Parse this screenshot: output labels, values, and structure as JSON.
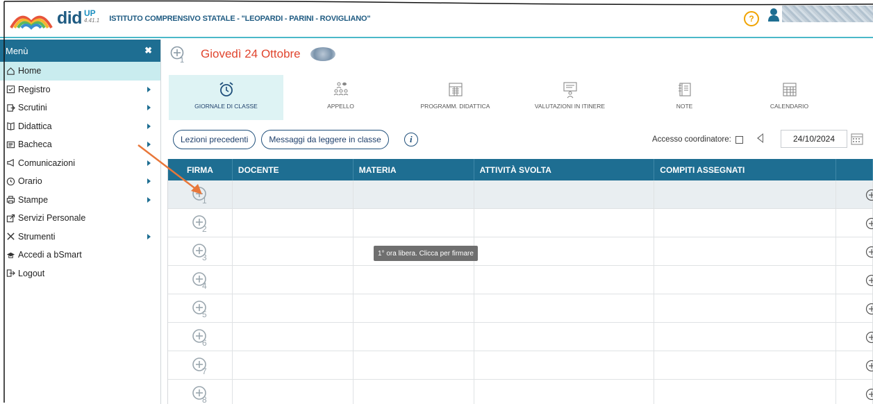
{
  "topbar": {
    "logo_did": "did",
    "logo_up": "UP",
    "logo_version": "4.41.1",
    "school_name": "ISTITUTO COMPRENSIVO STATALE - \"LEOPARDI - PARINI - ROVIGLIANO\"",
    "help_label": "?"
  },
  "sidebar": {
    "header": "Menù",
    "close": "✖",
    "items": [
      {
        "label": "Home",
        "icon": "home-icon",
        "active": true,
        "submenu": false
      },
      {
        "label": "Registro",
        "icon": "checklist-icon",
        "submenu": true
      },
      {
        "label": "Scrutini",
        "icon": "export-icon",
        "submenu": true
      },
      {
        "label": "Didattica",
        "icon": "book-icon",
        "submenu": true
      },
      {
        "label": "Bacheca",
        "icon": "board-icon",
        "submenu": true
      },
      {
        "label": "Comunicazioni",
        "icon": "megaphone-icon",
        "submenu": true
      },
      {
        "label": "Orario",
        "icon": "clock-icon",
        "submenu": true
      },
      {
        "label": "Stampe",
        "icon": "printer-icon",
        "submenu": true
      },
      {
        "label": "Servizi Personale",
        "icon": "share-icon",
        "submenu": false
      },
      {
        "label": "Strumenti",
        "icon": "tools-icon",
        "submenu": true
      },
      {
        "label": "Accedi a bSmart",
        "icon": "graduation-icon",
        "submenu": false
      },
      {
        "label": "Logout",
        "icon": "logout-icon",
        "submenu": false
      }
    ]
  },
  "main": {
    "day_number": "1",
    "day_title": "Giovedì 24 Ottobre",
    "tabs": [
      {
        "label": "GIORNALE DI CLASSE",
        "icon": "alarm-clock-icon",
        "active": true
      },
      {
        "label": "APPELLO",
        "icon": "students-icon"
      },
      {
        "label": "PROGRAMM. DIDATTICA",
        "icon": "calendar-grid-icon"
      },
      {
        "label": "VALUTAZIONI IN ITINERE",
        "icon": "presentation-icon"
      },
      {
        "label": "NOTE",
        "icon": "notebook-icon"
      },
      {
        "label": "CALENDARIO",
        "icon": "calendar-icon"
      }
    ],
    "buttons": {
      "previous_lessons": "Lezioni precedenti",
      "class_messages": "Messaggi da leggere in classe",
      "info": "i"
    },
    "coordinator_label": "Accesso coordinatore:",
    "coordinator_checked": false,
    "date": "24/10/2024",
    "table": {
      "headers": [
        "FIRMA",
        "DOCENTE",
        "MATERIA",
        "ATTIVITÀ SVOLTA",
        "COMPITI ASSEGNATI"
      ],
      "rows": [
        {
          "hour": "1"
        },
        {
          "hour": "2"
        },
        {
          "hour": "3"
        },
        {
          "hour": "4"
        },
        {
          "hour": "5"
        },
        {
          "hour": "6"
        },
        {
          "hour": "7"
        },
        {
          "hour": "8"
        }
      ]
    },
    "tooltip": "1° ora libera. Clicca per firmare"
  },
  "colors": {
    "accent": "#1e6e92",
    "title_red": "#e0452e",
    "active_tab_bg": "#def3f4",
    "annotation_arrow": "#e8773a"
  }
}
